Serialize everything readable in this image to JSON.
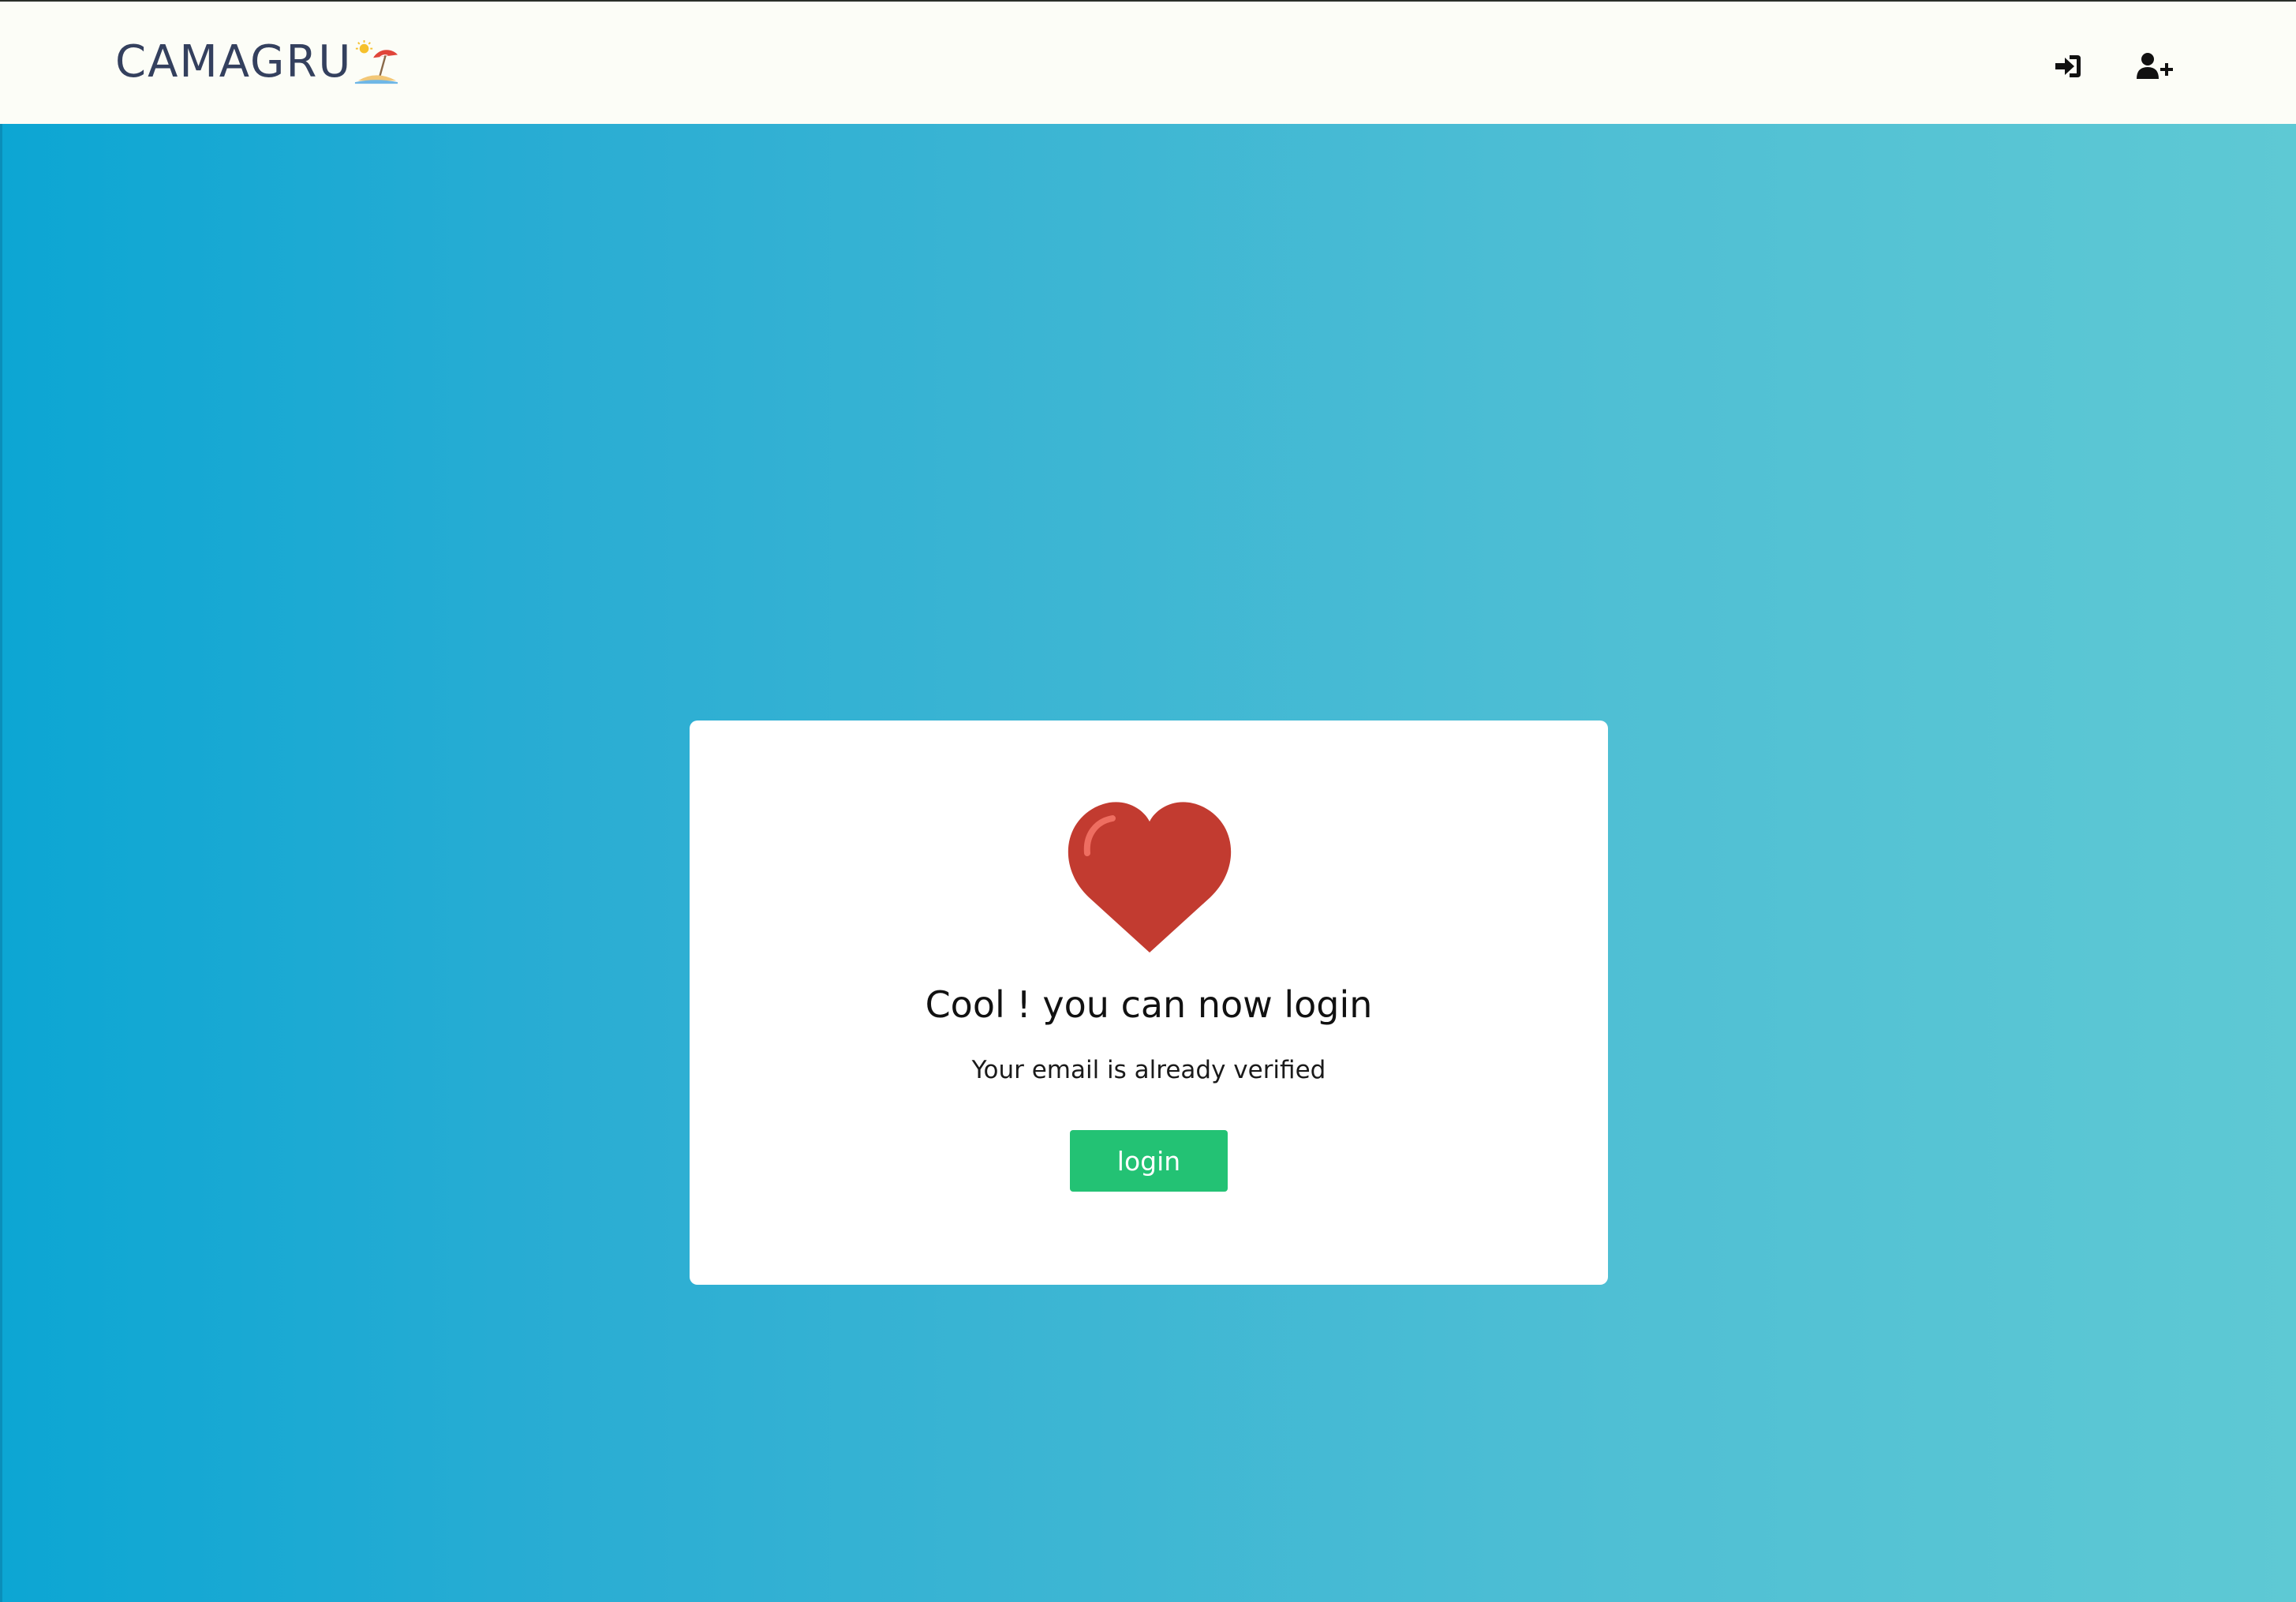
{
  "header": {
    "brand": "CAMAGRU",
    "brand_icon": "beach-umbrella-icon",
    "login_icon": "sign-in-icon",
    "signup_icon": "user-plus-icon"
  },
  "card": {
    "icon": "heart-icon",
    "title": "Cool ! you can now login",
    "message": "Your email is already verified",
    "button_label": "login"
  },
  "colors": {
    "nav_bg": "#fcfdf7",
    "brand_text": "#34405e",
    "gradient_start": "#0ca6d3",
    "gradient_end": "#5ec9d4",
    "heart": "#c23b30",
    "button": "#23c274"
  }
}
